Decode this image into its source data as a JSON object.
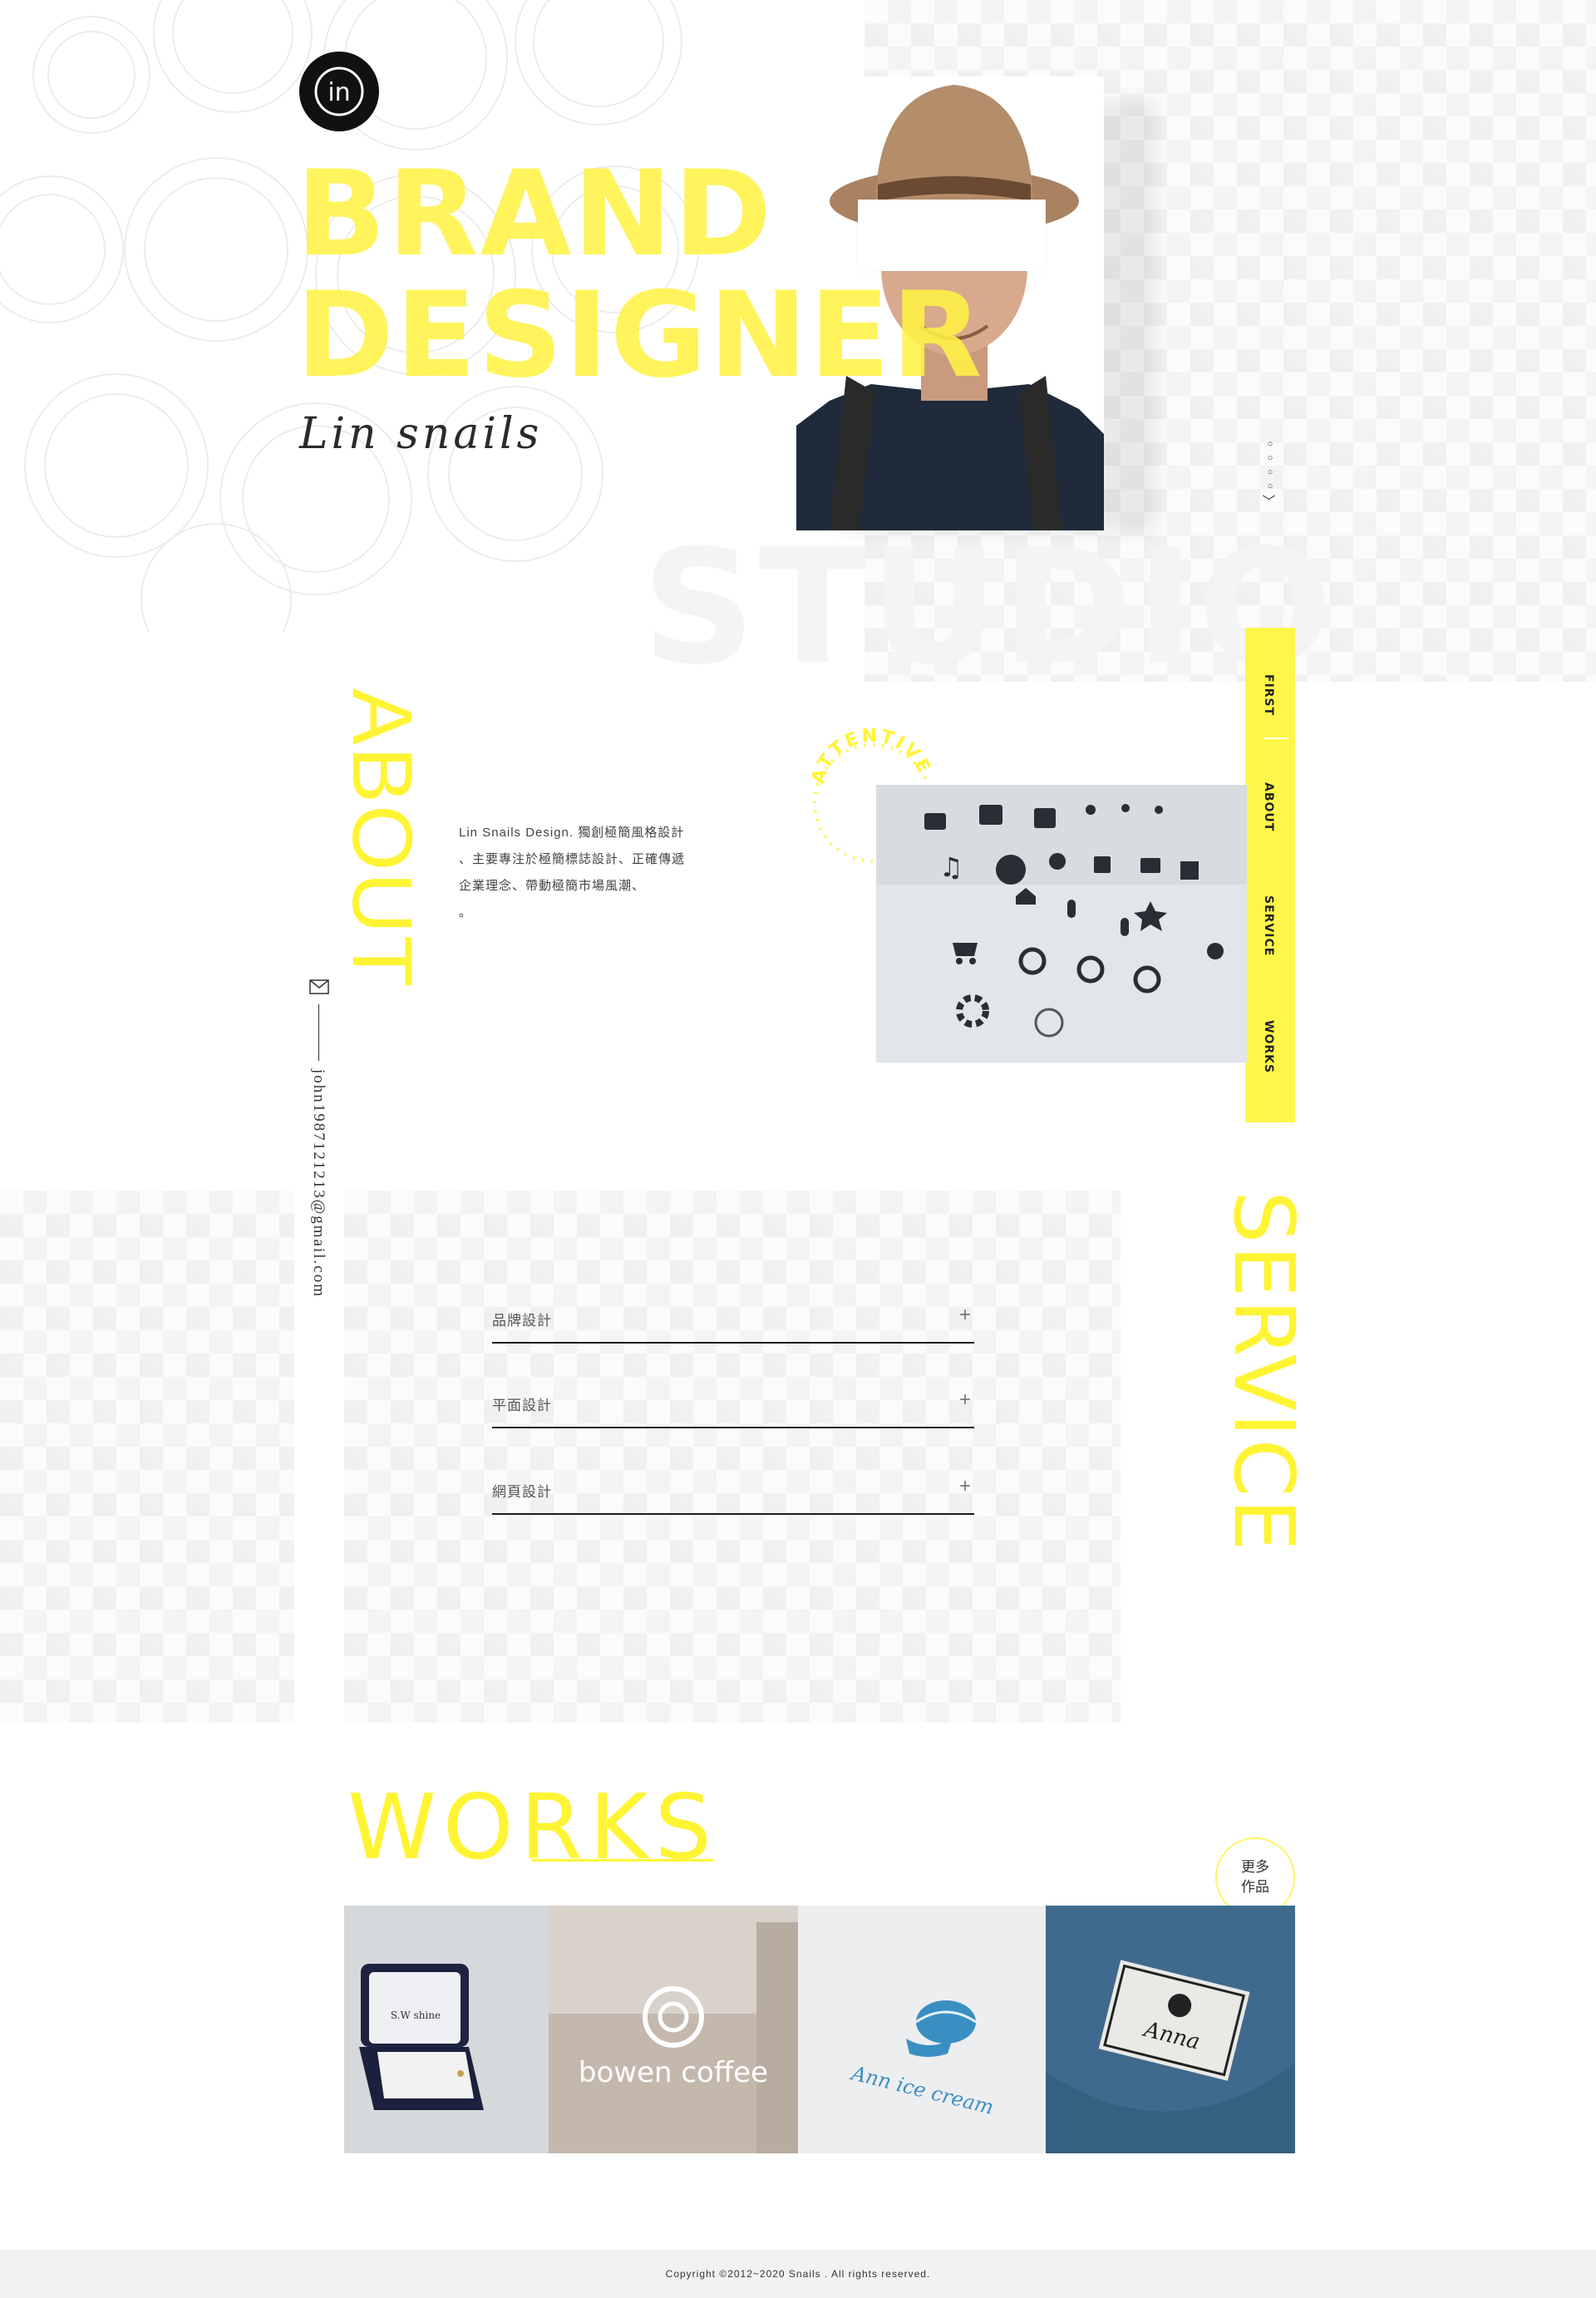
{
  "hero": {
    "logo_text": "in",
    "title_line1": "BRAND",
    "title_line2": "DESIGNER",
    "signature": "Lin snails",
    "bg_word": "STUDIO",
    "scroll_glyphs": [
      "○",
      "○",
      "○",
      "○",
      "〈"
    ]
  },
  "nav": {
    "items": [
      {
        "label": "FIRST",
        "active": true
      },
      {
        "label": "ABOUT",
        "active": false
      },
      {
        "label": "SERVICE",
        "active": false
      },
      {
        "label": "WORKS",
        "active": false
      }
    ],
    "color": "#fff64a"
  },
  "about": {
    "title": "ABOUT",
    "badge": "ATTENTIVE",
    "lines": [
      "Lin Snails Design. 獨創極簡風格設計",
      "、主要專注於極簡標誌設計、正確傳遞",
      "企業理念、帶動極簡市場風潮、",
      "。"
    ],
    "email": "john1987121213@gmail.com",
    "icon": "mail-icon"
  },
  "service": {
    "title": "SERVICE",
    "items": [
      {
        "label": "品牌設計"
      },
      {
        "label": "平面設計"
      },
      {
        "label": "網頁設計"
      }
    ]
  },
  "works": {
    "title": "WORKS",
    "more_line1": "更多",
    "more_line2": "作品",
    "items": [
      {
        "name": "S.W shine"
      },
      {
        "name": "bowen coffee"
      },
      {
        "name": "Ann ice cream"
      },
      {
        "name": "Anna"
      }
    ]
  },
  "footer": {
    "copyright": "Copyright ©2012~2020 Snails . All rights reserved."
  },
  "colors": {
    "accent": "#fff433",
    "dark": "#111111"
  }
}
